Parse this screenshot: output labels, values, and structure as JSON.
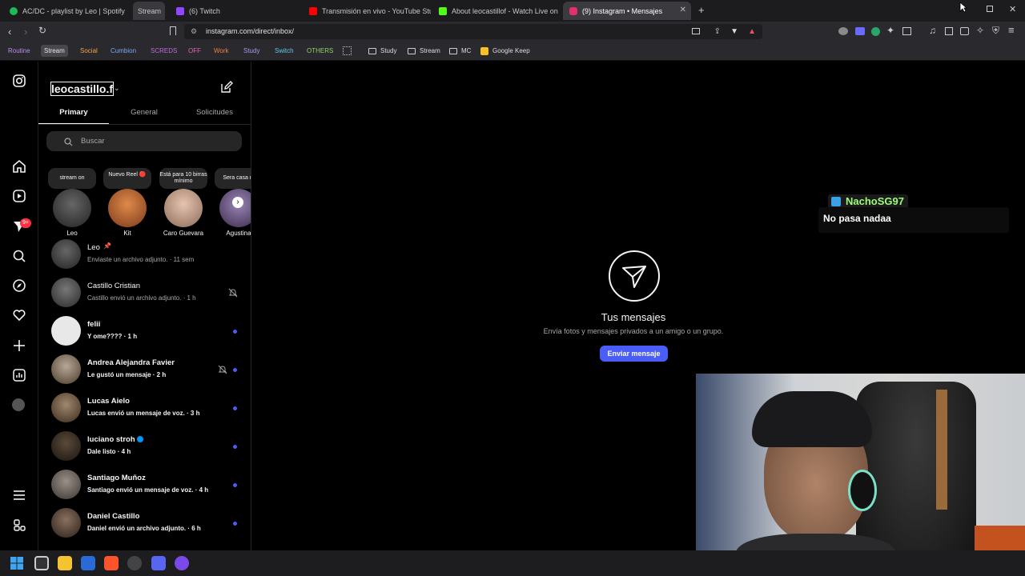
{
  "tabs": [
    {
      "label": "AC/DC - playlist by Leo | Spotify",
      "color": "#1db954"
    },
    {
      "label": "Stream",
      "color": ""
    },
    {
      "label": "(6) Twitch",
      "color": "#9146ff"
    },
    {
      "label": "Transmisión en vivo - YouTube Studio",
      "color": "#ff0000"
    },
    {
      "label": "About leocastillof - Watch Live on Kic",
      "color": "#53fc18"
    },
    {
      "label": "(9) Instagram • Mensajes",
      "color": "#e1306c"
    }
  ],
  "tab_new": "+",
  "url": "instagram.com/direct/inbox/",
  "bookmarks": [
    {
      "label": "Routine",
      "color": "#b98ef0"
    },
    {
      "label": "Stream",
      "color": "#e8e8e8"
    },
    {
      "label": "Social",
      "color": "#f2a44a"
    },
    {
      "label": "Cumbion",
      "color": "#7aa8f5"
    },
    {
      "label": "SCREDS",
      "color": "#c06ad8"
    },
    {
      "label": "OFF",
      "color": "#d86ab0"
    },
    {
      "label": "Work",
      "color": "#f07f4a"
    },
    {
      "label": "Study",
      "color": "#a69af0"
    },
    {
      "label": "Switch",
      "color": "#64c8e6"
    },
    {
      "label": "OTHERS",
      "color": "#8fd36a"
    }
  ],
  "bookmark_folders": [
    "Study",
    "Stream",
    "MC",
    "Google Keep"
  ],
  "inbox": {
    "username": "leocastillo.f",
    "tabs": [
      "Primary",
      "General",
      "Solicitudes"
    ],
    "search_placeholder": "Buscar",
    "stories": [
      {
        "note": "stream on",
        "name": "Leo",
        "color": "#3a3a3a"
      },
      {
        "note": "Nuevo Reel 🔴",
        "name": "Kit",
        "color": "#b86a3a"
      },
      {
        "note": "Está para 10 birras mínimo",
        "name": "Caro Guevara",
        "color": "#c9a48c"
      },
      {
        "note": "Sera casa m",
        "name": "Agustina",
        "color": "#6d5a8a"
      }
    ],
    "conversations": [
      {
        "name": "Leo",
        "preview": "Enviaste un archivo adjunto. · 11 sem",
        "unread": false,
        "muted": false,
        "avatar": "#3a3a3a"
      },
      {
        "name": "Castillo Cristian",
        "preview": "Castillo envió un archivo adjunto. · 1 h",
        "unread": false,
        "muted": true,
        "avatar": "#4a4a4a"
      },
      {
        "name": "felii",
        "preview": "Y ome???? · 1 h",
        "unread": true,
        "muted": false,
        "avatar": "#e8e8e8"
      },
      {
        "name": "Andrea Alejandra Favier",
        "preview": "Le gustó un mensaje · 2 h",
        "unread": true,
        "muted": true,
        "avatar": "#8a7a6a"
      },
      {
        "name": "Lucas Aielo",
        "preview": "Lucas envió un mensaje de voz. · 3 h",
        "unread": true,
        "muted": false,
        "avatar": "#6a5848"
      },
      {
        "name": "luciano stroh",
        "preview": "Dale listo · 4 h",
        "unread": true,
        "muted": false,
        "avatar": "#3a3028"
      },
      {
        "name": "Santiago Muñoz",
        "preview": "Santiago envió un mensaje de voz. · 4 h",
        "unread": true,
        "muted": false,
        "avatar": "#7a7068"
      },
      {
        "name": "Daniel Castillo",
        "preview": "Daniel envió un archivo adjunto. · 6 h",
        "unread": true,
        "muted": false,
        "avatar": "#5a4a3a"
      }
    ]
  },
  "main": {
    "title": "Tus mensajes",
    "subtitle": "Envía fotos y mensajes privados a un amigo o un grupo.",
    "button": "Enviar mensaje"
  },
  "overlay": {
    "user": "NachoSG97",
    "message": "No pasa nadaa"
  },
  "notif_badge": "9+",
  "colors": {
    "accent": "#4a5df9",
    "bg": "#000000",
    "muted_text": "#a8a8a8"
  }
}
